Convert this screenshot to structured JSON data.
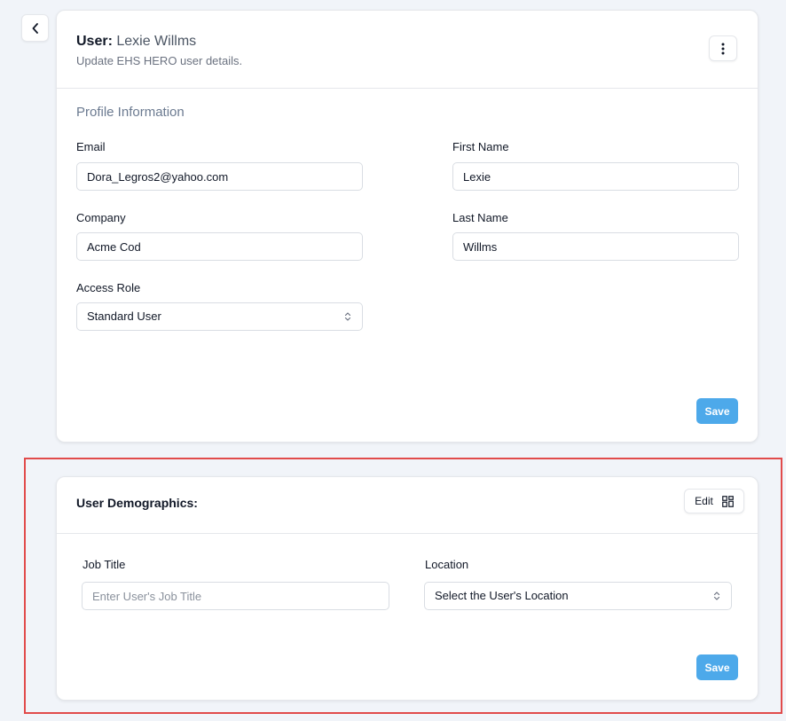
{
  "profile": {
    "title_prefix": "User:",
    "user_name": "Lexie Willms",
    "subtitle": "Update EHS HERO user details.",
    "section_title": "Profile Information",
    "email": {
      "label": "Email",
      "value": "Dora_Legros2@yahoo.com"
    },
    "first_name": {
      "label": "First Name",
      "value": "Lexie"
    },
    "company": {
      "label": "Company",
      "value": "Acme Cod"
    },
    "last_name": {
      "label": "Last Name",
      "value": "Willms"
    },
    "access_role": {
      "label": "Access Role",
      "value": "Standard User"
    },
    "save_label": "Save"
  },
  "demographics": {
    "title": "User Demographics:",
    "edit_label": "Edit",
    "job_title": {
      "label": "Job Title",
      "value": "",
      "placeholder": "Enter User's Job Title"
    },
    "location": {
      "label": "Location",
      "value": "Select the User's Location"
    },
    "save_label": "Save"
  },
  "icons": {
    "back": "chevron-left-icon",
    "menu": "vertical-dots-icon",
    "select": "chevron-up-down-icon",
    "edit": "grid-layout-icon"
  },
  "colors": {
    "accent": "#4da9ea",
    "highlight": "#e14b4b",
    "background": "#f1f4f9"
  }
}
